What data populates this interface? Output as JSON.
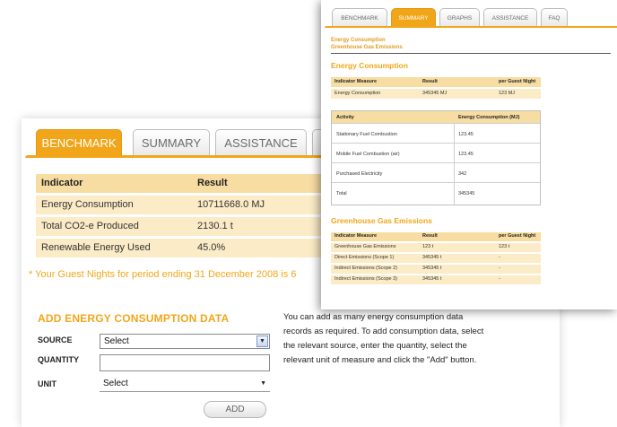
{
  "benchmark_panel": {
    "tabs": [
      {
        "label": "BENCHMARK",
        "active": true
      },
      {
        "label": "SUMMARY",
        "active": false
      },
      {
        "label": "ASSISTANCE",
        "active": false
      }
    ],
    "table": {
      "headers": [
        "Indicator",
        "Result"
      ],
      "rows": [
        {
          "indicator": "Energy Consumption",
          "result": "10711668.0 MJ"
        },
        {
          "indicator": "Total CO2-e Produced",
          "result": "2130.1 t"
        },
        {
          "indicator": "Renewable Energy Used",
          "result": "45.0%"
        }
      ]
    },
    "guest_note": "* Your Guest Nights for period ending 31 December 2008 is 6",
    "add_section": {
      "title": "ADD ENERGY CONSUMPTION DATA",
      "source_label": "SOURCE",
      "source_value": "Select",
      "quantity_label": "QUANTITY",
      "quantity_value": "",
      "unit_label": "UNIT",
      "unit_value": "Select",
      "add_button": "ADD",
      "help_text": "You can add as many energy consumption data records as required. To add consumption data, select the relevant source, enter the quantity, select the relevant unit of measure and click the \"Add\" button."
    }
  },
  "summary_panel": {
    "tabs": [
      {
        "label": "BENCHMARK",
        "active": false
      },
      {
        "label": "SUMMARY",
        "active": true
      },
      {
        "label": "GRAPHS",
        "active": false
      },
      {
        "label": "ASSISTANCE",
        "active": false
      },
      {
        "label": "FAQ",
        "active": false
      }
    ],
    "links": [
      "Energy Consumption",
      "Greenhouse Gas Emissions"
    ],
    "energy_section": {
      "title": "Energy Consumption",
      "headers": [
        "Indicator Measure",
        "Result",
        "per Guest Night"
      ],
      "rows": [
        {
          "measure": "Energy Consumption",
          "result": "345345 MJ",
          "per_guest": "123 MJ"
        }
      ]
    },
    "activity_table": {
      "headers": [
        "Activity",
        "Energy Consumption (MJ)"
      ],
      "rows": [
        {
          "activity": "Stationary Fuel Combustion",
          "value": "123.45"
        },
        {
          "activity": "Mobile Fuel Combustion (air)",
          "value": "123.45"
        },
        {
          "activity": "Purchased Electricity",
          "value": "342"
        },
        {
          "activity": "Total",
          "value": "345345"
        }
      ]
    },
    "ghg_section": {
      "title": "Greenhouse Gas Emissions",
      "headers": [
        "Indicator Measure",
        "Result",
        "per Guest Night"
      ],
      "rows": [
        {
          "measure": "Greenhouse Gas Emissions",
          "result": "123 t",
          "per_guest": "123 t"
        },
        {
          "measure": "Direct Emissions (Scope 1)",
          "result": "345345 t",
          "per_guest": "-"
        },
        {
          "measure": "Indirect Emissions (Scope 2)",
          "result": "345345 t",
          "per_guest": "-"
        },
        {
          "measure": "Indirect Emissions (Scope 3)",
          "result": "345345 t",
          "per_guest": "-"
        }
      ]
    }
  },
  "colors": {
    "accent": "#f1a61a",
    "header_row": "#f8dda3",
    "data_row": "#fbebc6"
  }
}
